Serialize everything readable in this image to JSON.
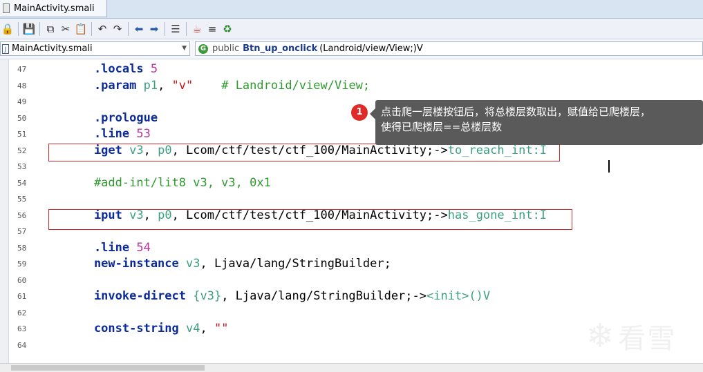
{
  "tab": {
    "title": "MainActivity.smali"
  },
  "toolbar": {
    "icons": [
      "lock-icon",
      "save-icon",
      "copy-icon",
      "cut-icon",
      "paste-icon",
      "undo-icon",
      "redo-icon",
      "back-icon",
      "forward-icon",
      "format-icon",
      "java-icon",
      "list-icon",
      "run-icon"
    ]
  },
  "nav": {
    "file_label": "MainActivity.smali",
    "file_badge": "J",
    "method_badge": "G",
    "method_public": "public",
    "method_name": "Btn_up_onclick",
    "method_sig": "(Landroid/view/View;)V"
  },
  "lines": [
    {
      "n": "47",
      "code": [
        {
          "t": "    .locals ",
          "c": "kw"
        },
        {
          "t": "5",
          "c": "num"
        }
      ]
    },
    {
      "n": "48",
      "code": [
        {
          "t": "    .param ",
          "c": "kw"
        },
        {
          "t": "p1",
          "c": "reg"
        },
        {
          "t": ", ",
          "c": "pl"
        },
        {
          "t": "\"v\"",
          "c": "str"
        },
        {
          "t": "    # Landroid/view/View;",
          "c": "cm"
        }
      ]
    },
    {
      "n": "49",
      "code": []
    },
    {
      "n": "50",
      "code": [
        {
          "t": "    .prologue",
          "c": "kw"
        }
      ]
    },
    {
      "n": "51",
      "code": [
        {
          "t": "    .line ",
          "c": "kw"
        },
        {
          "t": "53",
          "c": "num"
        }
      ]
    },
    {
      "n": "52",
      "code": [
        {
          "t": "    iget ",
          "c": "kw"
        },
        {
          "t": "v3",
          "c": "reg"
        },
        {
          "t": ", ",
          "c": "pl"
        },
        {
          "t": "p0",
          "c": "reg"
        },
        {
          "t": ", Lcom/ctf/test/ctf_100/MainActivity;->",
          "c": "pl"
        },
        {
          "t": "to_reach_int:I",
          "c": "reg"
        }
      ]
    },
    {
      "n": "53",
      "code": []
    },
    {
      "n": "54",
      "code": [
        {
          "t": "    #add-int/lit8 v3, v3, 0x1",
          "c": "cm"
        }
      ]
    },
    {
      "n": "55",
      "code": []
    },
    {
      "n": "56",
      "code": [
        {
          "t": "    iput ",
          "c": "kw"
        },
        {
          "t": "v3",
          "c": "reg"
        },
        {
          "t": ", ",
          "c": "pl"
        },
        {
          "t": "p0",
          "c": "reg"
        },
        {
          "t": ", Lcom/ctf/test/ctf_100/MainActivity;->",
          "c": "pl"
        },
        {
          "t": "has_gone_int:I",
          "c": "reg"
        }
      ]
    },
    {
      "n": "57",
      "code": []
    },
    {
      "n": "58",
      "code": [
        {
          "t": "    .line ",
          "c": "kw"
        },
        {
          "t": "54",
          "c": "num"
        }
      ]
    },
    {
      "n": "59",
      "code": [
        {
          "t": "    new-instance ",
          "c": "kw"
        },
        {
          "t": "v3",
          "c": "reg"
        },
        {
          "t": ", Ljava/lang/StringBuilder;",
          "c": "pl"
        }
      ]
    },
    {
      "n": "60",
      "code": []
    },
    {
      "n": "61",
      "code": [
        {
          "t": "    invoke-direct ",
          "c": "kw"
        },
        {
          "t": "{v3}",
          "c": "reg"
        },
        {
          "t": ", Ljava/lang/StringBuilder;->",
          "c": "pl"
        },
        {
          "t": "<init>()V",
          "c": "reg"
        }
      ]
    },
    {
      "n": "62",
      "code": []
    },
    {
      "n": "63",
      "code": [
        {
          "t": "    const-string ",
          "c": "kw"
        },
        {
          "t": "v4",
          "c": "reg"
        },
        {
          "t": ", ",
          "c": "pl"
        },
        {
          "t": "\"\"",
          "c": "str"
        }
      ]
    },
    {
      "n": "64",
      "code": []
    }
  ],
  "tooltip": {
    "badge": "1",
    "line1": "点击爬一层楼按钮后，将总楼层数取出，赋值给已爬楼层，",
    "line2": "使得已爬楼层==总楼层数"
  },
  "watermark": {
    "text": "看雪"
  }
}
